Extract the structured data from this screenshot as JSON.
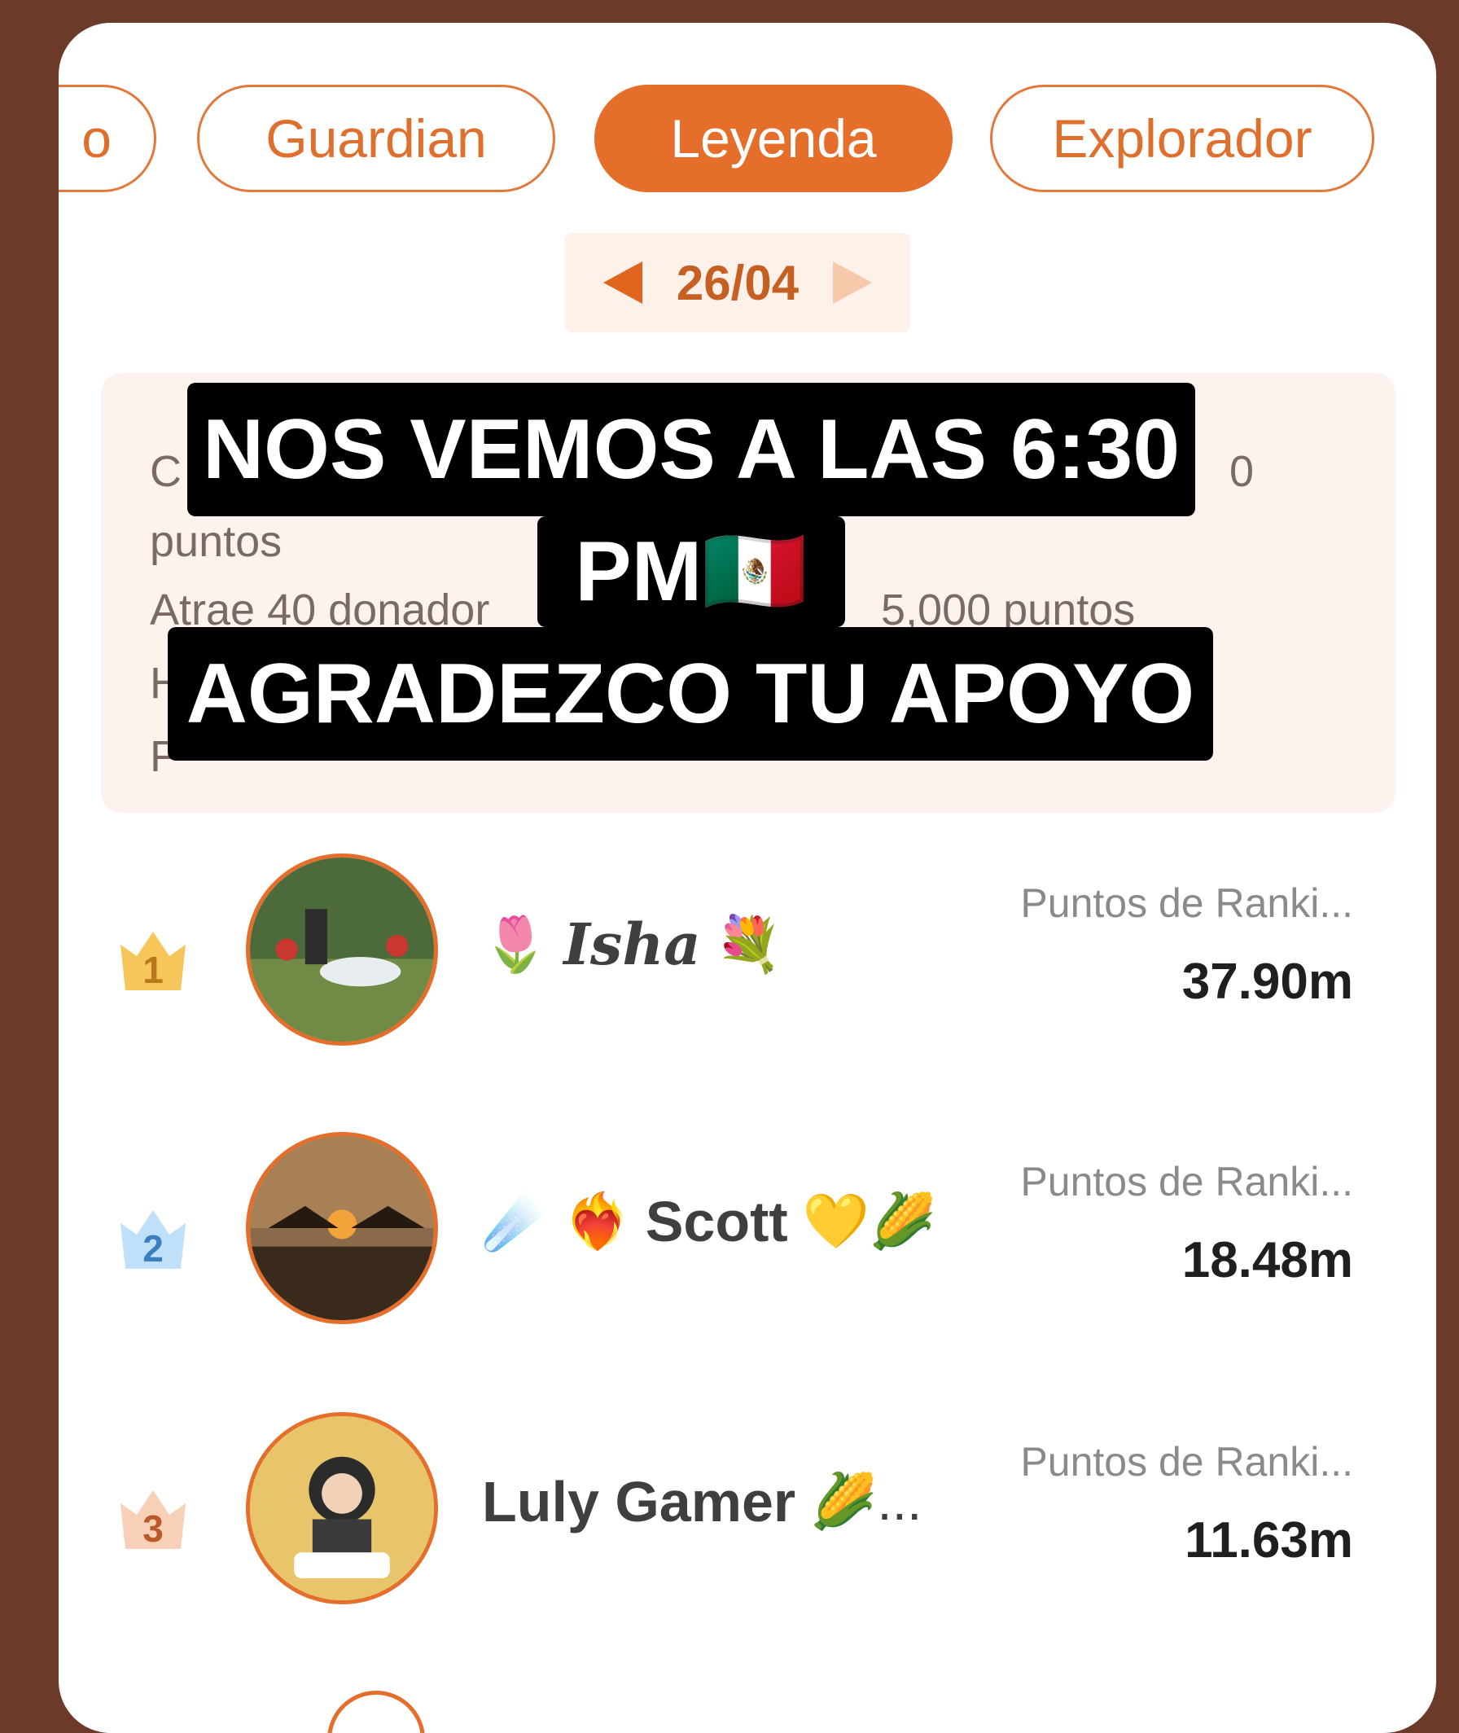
{
  "tabs": [
    {
      "label": "o",
      "active": false
    },
    {
      "label": "Guardian",
      "active": false
    },
    {
      "label": "Leyenda",
      "active": true
    },
    {
      "label": "Explorador",
      "active": false
    }
  ],
  "date": {
    "value": "26/04"
  },
  "info": {
    "line1_start": "C",
    "line1_end": "0",
    "line2": "puntos",
    "line3_start": "Atrae 40 donador",
    "line3_end": "5,000 puntos",
    "line4_start": "H",
    "line5_start": "F"
  },
  "caption": {
    "line1": "NOS VEMOS A LAS 6:30",
    "line2": "PM🇲🇽",
    "line3": "AGRADEZCO TU APOYO"
  },
  "leaderboard": [
    {
      "rank": "1",
      "name": "Isha",
      "emoji_before": "🌷",
      "emoji_after": "💐",
      "points_label": "Puntos de Ranki...",
      "points": "37.90m",
      "crown_color": "#f6c65b",
      "number_color": "#b8791d"
    },
    {
      "rank": "2",
      "name": "Scott",
      "emoji_before": "☄️ ❤️‍🔥",
      "emoji_after": "💛🌽",
      "points_label": "Puntos de Ranki...",
      "points": "18.48m",
      "crown_color": "#bfe0f8",
      "number_color": "#3a7fc0"
    },
    {
      "rank": "3",
      "name": "Luly Gamer",
      "emoji_before": "",
      "emoji_after": "🌽...",
      "points_label": "Puntos de Ranki...",
      "points": "11.63m",
      "crown_color": "#f8cfb7",
      "number_color": "#b85a2a"
    }
  ]
}
